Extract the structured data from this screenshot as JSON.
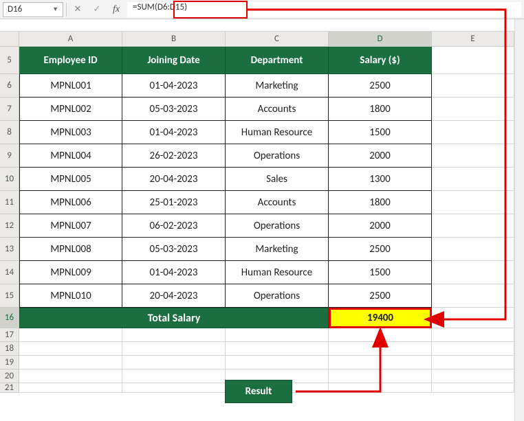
{
  "formula_bar": {
    "name_box": "D16",
    "fx_label": "fx",
    "formula": "=SUM(D6:D15)"
  },
  "columns": [
    "A",
    "B",
    "C",
    "D",
    "E"
  ],
  "row_numbers": [
    5,
    6,
    7,
    8,
    9,
    10,
    11,
    12,
    13,
    14,
    15,
    16,
    17,
    18,
    19,
    20,
    21
  ],
  "headers": {
    "A": "Employee ID",
    "B": "Joining Date",
    "C": "Department",
    "D": "Salary ($)"
  },
  "rows": [
    {
      "id": "MPNL001",
      "date": "01-04-2023",
      "dept": "Marketing",
      "salary": "2500"
    },
    {
      "id": "MPNL002",
      "date": "05-03-2023",
      "dept": "Accounts",
      "salary": "1800"
    },
    {
      "id": "MPNL003",
      "date": "01-04-2023",
      "dept": "Human Resource",
      "salary": "1500"
    },
    {
      "id": "MPNL004",
      "date": "26-02-2023",
      "dept": "Operations",
      "salary": "2000"
    },
    {
      "id": "MPNL005",
      "date": "20-04-2023",
      "dept": "Sales",
      "salary": "1300"
    },
    {
      "id": "MPNL006",
      "date": "25-01-2023",
      "dept": "Accounts",
      "salary": "1800"
    },
    {
      "id": "MPNL007",
      "date": "06-02-2023",
      "dept": "Operations",
      "salary": "2000"
    },
    {
      "id": "MPNL008",
      "date": "05-03-2023",
      "dept": "Marketing",
      "salary": "2500"
    },
    {
      "id": "MPNL009",
      "date": "01-04-2023",
      "dept": "Human Resource",
      "salary": "1500"
    },
    {
      "id": "MPNL010",
      "date": "20-04-2023",
      "dept": "Operations",
      "salary": "2500"
    }
  ],
  "total": {
    "label": "Total Salary",
    "value": "19400"
  },
  "callout": {
    "result": "Result"
  },
  "chart_data": {
    "type": "table",
    "title": "Employee Salary Table",
    "columns": [
      "Employee ID",
      "Joining Date",
      "Department",
      "Salary ($)"
    ],
    "data": [
      [
        "MPNL001",
        "01-04-2023",
        "Marketing",
        2500
      ],
      [
        "MPNL002",
        "05-03-2023",
        "Accounts",
        1800
      ],
      [
        "MPNL003",
        "01-04-2023",
        "Human Resource",
        1500
      ],
      [
        "MPNL004",
        "26-02-2023",
        "Operations",
        2000
      ],
      [
        "MPNL005",
        "20-04-2023",
        "Sales",
        1300
      ],
      [
        "MPNL006",
        "25-01-2023",
        "Accounts",
        1800
      ],
      [
        "MPNL007",
        "06-02-2023",
        "Operations",
        2000
      ],
      [
        "MPNL008",
        "05-03-2023",
        "Marketing",
        2500
      ],
      [
        "MPNL009",
        "01-04-2023",
        "Human Resource",
        1500
      ],
      [
        "MPNL010",
        "20-04-2023",
        "Operations",
        2500
      ]
    ],
    "total_salary": 19400,
    "formula": "=SUM(D6:D15)"
  }
}
